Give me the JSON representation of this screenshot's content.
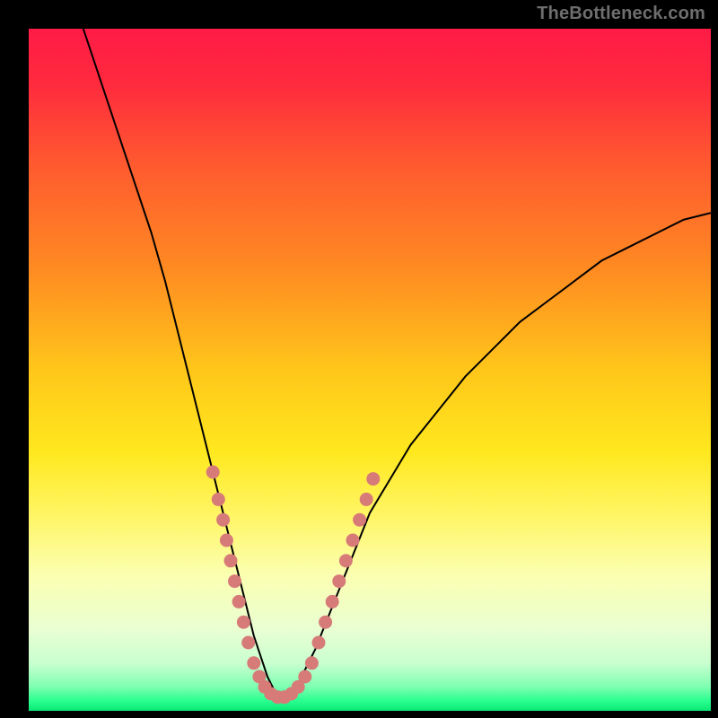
{
  "watermark": "TheBottleneck.com",
  "colors": {
    "frame": "#000000",
    "curve": "#000000",
    "marker_fill": "#d77b79",
    "marker_stroke": "#d77b79",
    "gradient_stops": [
      {
        "offset": 0.0,
        "color": "#ff1b46"
      },
      {
        "offset": 0.08,
        "color": "#ff2a3e"
      },
      {
        "offset": 0.2,
        "color": "#ff5a2f"
      },
      {
        "offset": 0.35,
        "color": "#ff8a22"
      },
      {
        "offset": 0.5,
        "color": "#ffc61a"
      },
      {
        "offset": 0.62,
        "color": "#ffe81e"
      },
      {
        "offset": 0.72,
        "color": "#fff66a"
      },
      {
        "offset": 0.8,
        "color": "#fbffb0"
      },
      {
        "offset": 0.88,
        "color": "#eaffd2"
      },
      {
        "offset": 0.93,
        "color": "#c9ffd0"
      },
      {
        "offset": 0.965,
        "color": "#7dffb0"
      },
      {
        "offset": 0.985,
        "color": "#2bff8f"
      },
      {
        "offset": 1.0,
        "color": "#08e874"
      }
    ]
  },
  "chart_data": {
    "type": "line",
    "title": "",
    "xlabel": "",
    "ylabel": "",
    "xlim": [
      0,
      100
    ],
    "ylim": [
      0,
      100
    ],
    "series": [
      {
        "name": "bottleneck-curve",
        "x": [
          8,
          10,
          12,
          14,
          16,
          18,
          20,
          22,
          24,
          26,
          27,
          28,
          29,
          30,
          31,
          32,
          33,
          34,
          35,
          36,
          37,
          38,
          39,
          40,
          42,
          44,
          46,
          48,
          50,
          53,
          56,
          60,
          64,
          68,
          72,
          76,
          80,
          84,
          88,
          92,
          96,
          100
        ],
        "y": [
          100,
          94,
          88,
          82,
          76,
          70,
          63,
          55,
          47,
          39,
          35,
          31,
          27,
          23,
          19,
          15,
          11,
          8,
          5,
          3,
          2,
          2,
          3,
          5,
          9,
          14,
          19,
          24,
          29,
          34,
          39,
          44,
          49,
          53,
          57,
          60,
          63,
          66,
          68,
          70,
          72,
          73
        ]
      }
    ],
    "markers": {
      "name": "highlight-dots",
      "points": [
        {
          "x": 27.0,
          "y": 35
        },
        {
          "x": 27.8,
          "y": 31
        },
        {
          "x": 28.5,
          "y": 28
        },
        {
          "x": 29.0,
          "y": 25
        },
        {
          "x": 29.6,
          "y": 22
        },
        {
          "x": 30.2,
          "y": 19
        },
        {
          "x": 30.8,
          "y": 16
        },
        {
          "x": 31.5,
          "y": 13
        },
        {
          "x": 32.2,
          "y": 10
        },
        {
          "x": 33.0,
          "y": 7
        },
        {
          "x": 33.8,
          "y": 5
        },
        {
          "x": 34.6,
          "y": 3.5
        },
        {
          "x": 35.5,
          "y": 2.5
        },
        {
          "x": 36.5,
          "y": 2.0
        },
        {
          "x": 37.5,
          "y": 2.0
        },
        {
          "x": 38.5,
          "y": 2.5
        },
        {
          "x": 39.5,
          "y": 3.5
        },
        {
          "x": 40.5,
          "y": 5
        },
        {
          "x": 41.5,
          "y": 7
        },
        {
          "x": 42.5,
          "y": 10
        },
        {
          "x": 43.5,
          "y": 13
        },
        {
          "x": 44.5,
          "y": 16
        },
        {
          "x": 45.5,
          "y": 19
        },
        {
          "x": 46.5,
          "y": 22
        },
        {
          "x": 47.5,
          "y": 25
        },
        {
          "x": 48.5,
          "y": 28
        },
        {
          "x": 49.5,
          "y": 31
        },
        {
          "x": 50.5,
          "y": 34
        }
      ]
    }
  }
}
